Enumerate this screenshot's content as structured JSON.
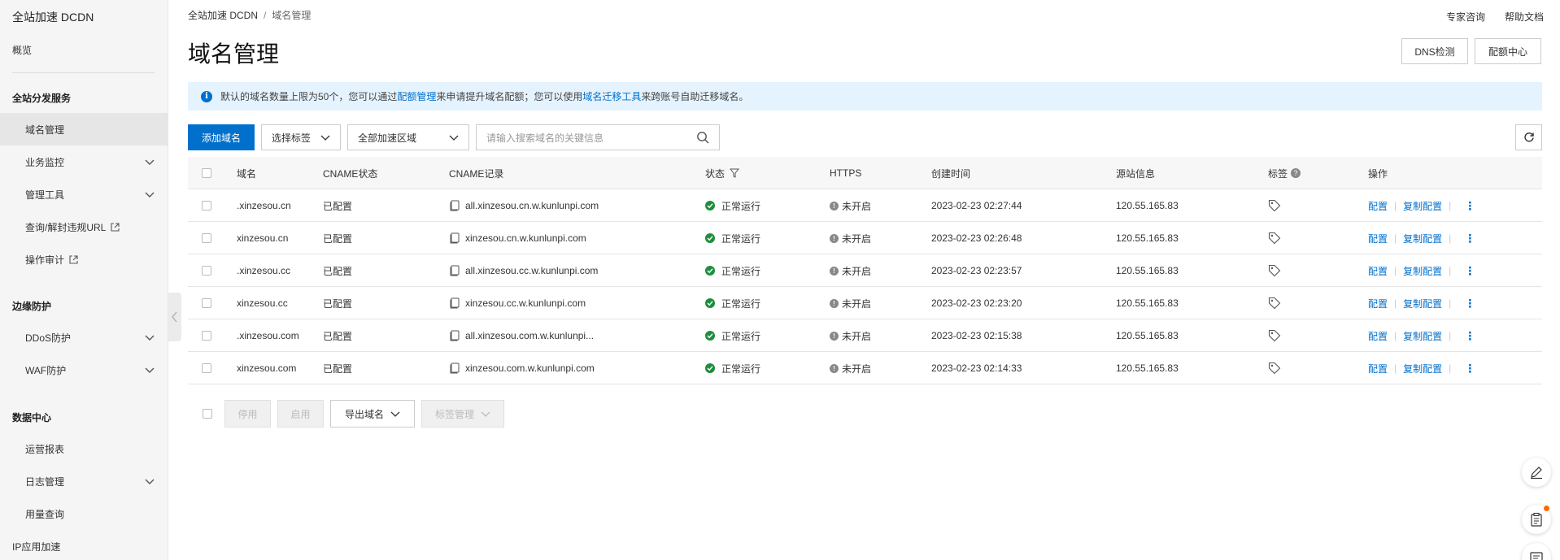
{
  "sidebar": {
    "title": "全站加速 DCDN",
    "overview": "概览",
    "group1": "全站分发服务",
    "items1": [
      {
        "label": "域名管理"
      },
      {
        "label": "业务监控"
      },
      {
        "label": "管理工具"
      },
      {
        "label": "查询/解封违规URL"
      },
      {
        "label": "操作审计"
      }
    ],
    "group2": "边缘防护",
    "items2": [
      {
        "label": "DDoS防护"
      },
      {
        "label": "WAF防护"
      }
    ],
    "group3": "数据中心",
    "items3": [
      {
        "label": "运营报表"
      },
      {
        "label": "日志管理"
      },
      {
        "label": "用量查询"
      }
    ],
    "ip_accel": "IP应用加速"
  },
  "breadcrumb": {
    "root": "全站加速 DCDN",
    "sep": "/",
    "current": "域名管理"
  },
  "top_links": {
    "expert": "专家咨询",
    "help": "帮助文档"
  },
  "page_title": "域名管理",
  "header_buttons": {
    "dns": "DNS检测",
    "quota": "配额中心"
  },
  "notice": {
    "part1": "默认的域名数量上限为50个，您可以通过",
    "link1": "配额管理",
    "part2": "来申请提升域名配额；您可以使用",
    "link2": "域名迁移工具",
    "part3": "来跨账号自助迁移域名。"
  },
  "toolbar": {
    "add": "添加域名",
    "tag_select": "选择标签",
    "region_select": "全部加速区域",
    "search_placeholder": "请输入搜索域名的关键信息"
  },
  "table": {
    "headers": {
      "domain": "域名",
      "cname_status": "CNAME状态",
      "cname_record": "CNAME记录",
      "status": "状态",
      "https": "HTTPS",
      "created": "创建时间",
      "origin": "源站信息",
      "tag": "标签",
      "actions": "操作"
    },
    "rows": [
      {
        "domain": ".xinzesou.cn",
        "cname_status": "已配置",
        "cname": "all.xinzesou.cn.w.kunlunpi.com",
        "status": "正常运行",
        "https": "未开启",
        "created": "2023-02-23 02:27:44",
        "origin": "120.55.165.83",
        "config": "配置",
        "copy": "复制配置"
      },
      {
        "domain": "xinzesou.cn",
        "cname_status": "已配置",
        "cname": "xinzesou.cn.w.kunlunpi.com",
        "status": "正常运行",
        "https": "未开启",
        "created": "2023-02-23 02:26:48",
        "origin": "120.55.165.83",
        "config": "配置",
        "copy": "复制配置"
      },
      {
        "domain": ".xinzesou.cc",
        "cname_status": "已配置",
        "cname": "all.xinzesou.cc.w.kunlunpi.com",
        "status": "正常运行",
        "https": "未开启",
        "created": "2023-02-23 02:23:57",
        "origin": "120.55.165.83",
        "config": "配置",
        "copy": "复制配置"
      },
      {
        "domain": "xinzesou.cc",
        "cname_status": "已配置",
        "cname": "xinzesou.cc.w.kunlunpi.com",
        "status": "正常运行",
        "https": "未开启",
        "created": "2023-02-23 02:23:20",
        "origin": "120.55.165.83",
        "config": "配置",
        "copy": "复制配置"
      },
      {
        "domain": ".xinzesou.com",
        "cname_status": "已配置",
        "cname": "all.xinzesou.com.w.kunlunpi...",
        "status": "正常运行",
        "https": "未开启",
        "created": "2023-02-23 02:15:38",
        "origin": "120.55.165.83",
        "config": "配置",
        "copy": "复制配置"
      },
      {
        "domain": "xinzesou.com",
        "cname_status": "已配置",
        "cname": "xinzesou.com.w.kunlunpi.com",
        "status": "正常运行",
        "https": "未开启",
        "created": "2023-02-23 02:14:33",
        "origin": "120.55.165.83",
        "config": "配置",
        "copy": "复制配置"
      }
    ]
  },
  "bulk": {
    "stop": "停用",
    "start": "启用",
    "export": "导出域名",
    "tags": "标签管理"
  },
  "colors": {
    "primary": "#0070cc",
    "ok": "#1e8e3e",
    "notice_bg": "#e5f3ff"
  }
}
